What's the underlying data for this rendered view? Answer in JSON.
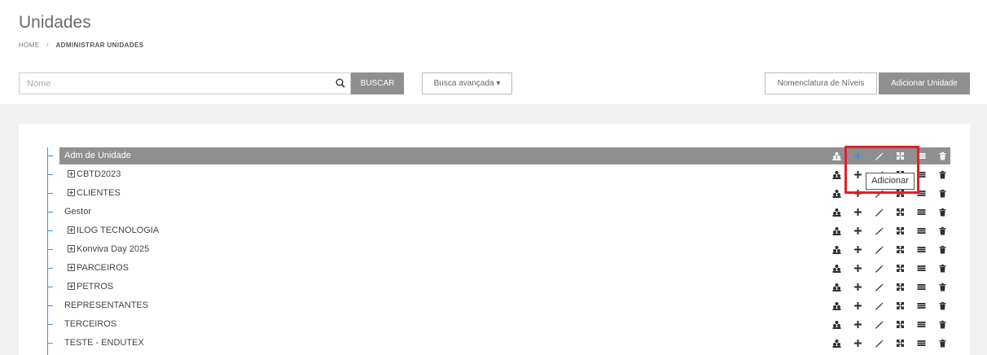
{
  "page": {
    "title": "Unidades"
  },
  "breadcrumb": {
    "home": "HOME",
    "separator": "/",
    "current": "ADMINISTRAR UNIDADES"
  },
  "search": {
    "placeholder": "Nome",
    "value": "",
    "icon": "search-icon",
    "button_label": "BUSCAR"
  },
  "advanced_search": {
    "label": "Busca avançada ▾"
  },
  "toolbar": {
    "nomenclatura_label": "Nomenclatura de Níveis",
    "adicionar_label": "Adicionar Unidade"
  },
  "colors": {
    "accent_blue": "#4a90c8",
    "selected_row": "#8f8f8f",
    "highlight_red": "#e0202a"
  },
  "tree": {
    "rows": [
      {
        "label": "Adm de Unidade",
        "expandable": false,
        "selected": true
      },
      {
        "label": "CBTD2023",
        "expandable": true,
        "selected": false
      },
      {
        "label": "CLIENTES",
        "expandable": true,
        "selected": false
      },
      {
        "label": "Gestor",
        "expandable": false,
        "selected": false
      },
      {
        "label": "ILOG TECNOLOGIA",
        "expandable": true,
        "selected": false
      },
      {
        "label": "Konviva Day 2025",
        "expandable": true,
        "selected": false
      },
      {
        "label": "PARCEIROS",
        "expandable": true,
        "selected": false
      },
      {
        "label": "PETROS",
        "expandable": true,
        "selected": false
      },
      {
        "label": "REPRESENTANTES",
        "expandable": false,
        "selected": false
      },
      {
        "label": "TERCEIROS",
        "expandable": false,
        "selected": false
      },
      {
        "label": "TESTE - ENDUTEX",
        "expandable": false,
        "selected": false
      }
    ],
    "row_actions": [
      "users-group-icon",
      "add-icon",
      "edit-icon",
      "move-icon",
      "list-icon",
      "trash-icon"
    ]
  },
  "tooltip": {
    "text": "Adicionar"
  }
}
